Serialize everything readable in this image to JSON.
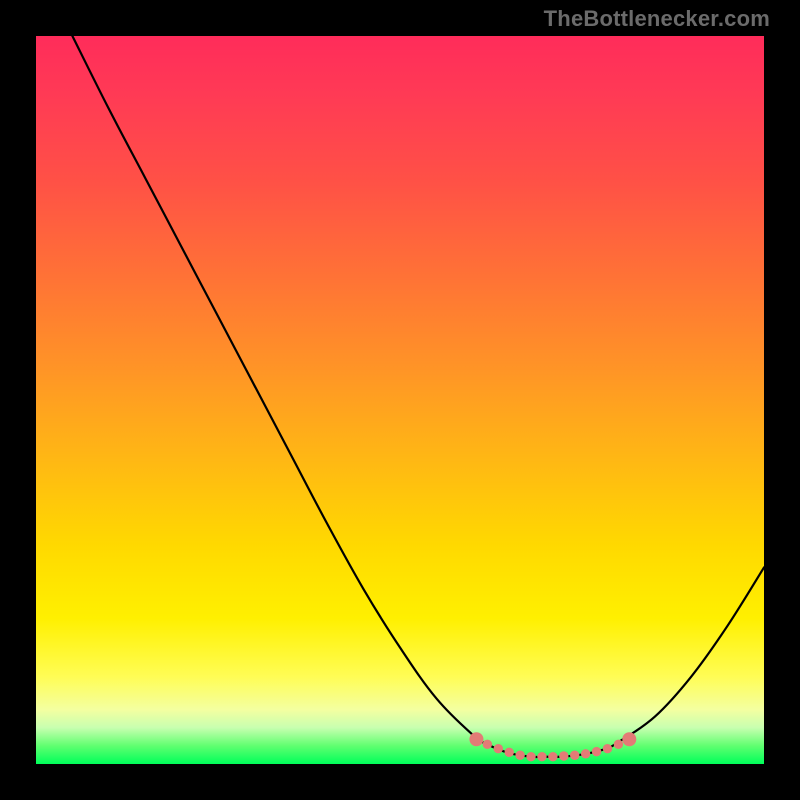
{
  "attribution_label": "TheBottlenecker.com",
  "chart_data": {
    "type": "line",
    "title": "",
    "xlabel": "",
    "ylabel": "",
    "xlim": [
      0,
      100
    ],
    "ylim": [
      0,
      100
    ],
    "series": [
      {
        "name": "bottleneck-curve",
        "x": [
          5,
          10,
          15,
          20,
          25,
          30,
          35,
          40,
          45,
          50,
          55,
          60,
          62,
          65,
          68,
          70,
          72,
          75,
          78,
          80,
          85,
          90,
          95,
          100
        ],
        "values": [
          100,
          90,
          80.5,
          71,
          61.5,
          52,
          42.5,
          33,
          24,
          16,
          9,
          4,
          2.7,
          1.5,
          1,
          1,
          1,
          1.3,
          2,
          3,
          6.5,
          12,
          19,
          27
        ]
      }
    ],
    "markers": {
      "name": "highlighted-zone-dots",
      "color": "#e37b76",
      "points": [
        {
          "x": 60.5,
          "y": 3.4
        },
        {
          "x": 62.0,
          "y": 2.7
        },
        {
          "x": 63.5,
          "y": 2.1
        },
        {
          "x": 65.0,
          "y": 1.6
        },
        {
          "x": 66.5,
          "y": 1.2
        },
        {
          "x": 68.0,
          "y": 1.0
        },
        {
          "x": 69.5,
          "y": 1.0
        },
        {
          "x": 71.0,
          "y": 1.0
        },
        {
          "x": 72.5,
          "y": 1.1
        },
        {
          "x": 74.0,
          "y": 1.2
        },
        {
          "x": 75.5,
          "y": 1.4
        },
        {
          "x": 77.0,
          "y": 1.7
        },
        {
          "x": 78.5,
          "y": 2.1
        },
        {
          "x": 80.0,
          "y": 2.7
        },
        {
          "x": 81.5,
          "y": 3.4
        }
      ]
    },
    "gradient_colors": {
      "top": "#ff2c5a",
      "mid_upper": "#ff8a2e",
      "mid_lower": "#ffe400",
      "near_bottom": "#f4ffa0",
      "bottom": "#00ff5a"
    }
  }
}
